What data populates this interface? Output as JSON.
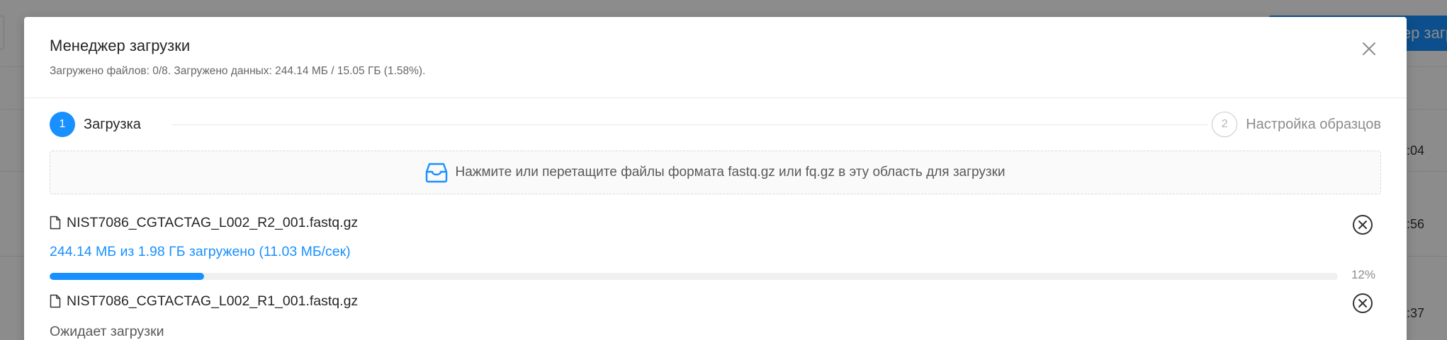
{
  "background": {
    "primary_button_label": "ер загр",
    "row_times": [
      ":04",
      ":56",
      ":37"
    ]
  },
  "modal": {
    "title": "Менеджер загрузки",
    "subtitle": "Загружено файлов: 0/8. Загружено данных: 244.14 МБ / 15.05 ГБ (1.58%).",
    "close_icon": "close-icon"
  },
  "steps": [
    {
      "number": "1",
      "title": "Загрузка",
      "status": "active"
    },
    {
      "number": "2",
      "title": "Настройка образцов",
      "status": "wait"
    }
  ],
  "dropzone": {
    "icon": "inbox-icon",
    "text": "Нажмите или перетащите файлы формата fastq.gz или fq.gz в эту область для загрузки"
  },
  "files": [
    {
      "name": "NIST7086_CGTACTAG_L002_R2_001.fastq.gz",
      "status_text": "244.14 МБ из 1.98 ГБ загружено (11.03 МБ/сек)",
      "progress_percent": 12,
      "progress_label": "12%"
    },
    {
      "name": "NIST7086_CGTACTAG_L002_R1_001.fastq.gz",
      "status_text": "Ожидает загрузки"
    }
  ],
  "colors": {
    "primary": "#1890ff",
    "overlay": "rgba(0,0,0,0.45)"
  }
}
